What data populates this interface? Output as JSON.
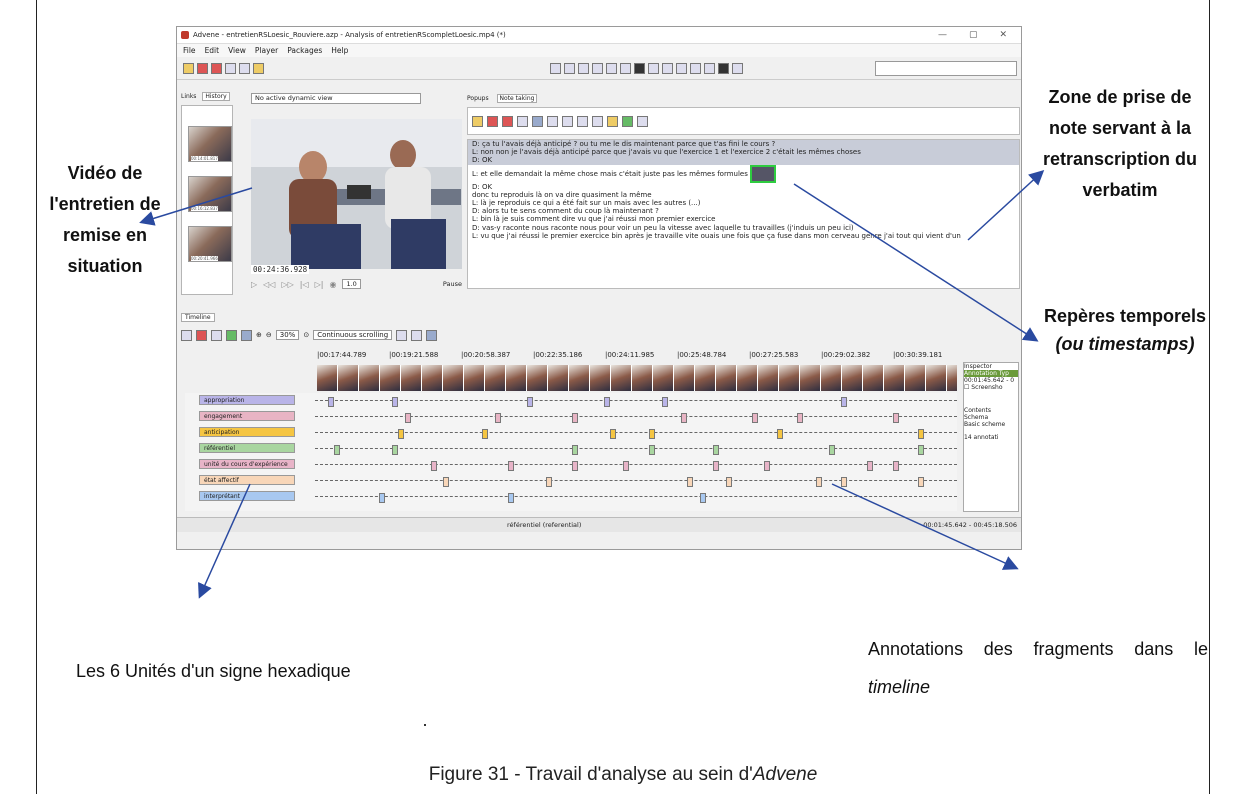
{
  "window": {
    "title": "Advene - entretienRSLoesic_Rouviere.azp - Analysis of entretienRScompletLoesic.mp4 (*)",
    "menu": [
      "File",
      "Edit",
      "View",
      "Player",
      "Packages",
      "Help"
    ],
    "left_tabs": [
      "Links",
      "History"
    ],
    "dynamic_view": "No active dynamic view",
    "video_time": "00:24:36.928",
    "speed": "1.0",
    "pause": "Pause",
    "note_tabs": [
      "Popups",
      "Note taking"
    ],
    "notes": [
      "D: ça tu l'avais déjà anticipé ? ou tu me le dis maintenant parce que t'as fini le cours ?",
      "L: non non je l'avais déjà anticipé parce que j'avais vu que l'exercice 1 et l'exercice 2 c'était les mêmes choses",
      "D: OK",
      "",
      "L: et elle demandait la même chose mais c'était juste pas les mêmes formules",
      "D: OK",
      "donc tu reproduis là on va dire quasiment la même",
      "L: là je reproduis ce qui a été fait sur un mais avec les autres (...)",
      "D: alors tu te sens comment du coup là maintenant ?",
      "L: bin là je suis comment dire vu que j'ai réussi mon premier exercice",
      "D: vas-y raconte nous raconte nous pour voir un peu la vitesse avec laquelle tu travailles (j'induis un peu ici)",
      "L: vu que j'ai réussi le premier exercice bin après je travaille vite ouais une fois que ça fuse dans mon cerveau genre j'ai tout qui vient d'un"
    ],
    "timeline_tab": "Timeline",
    "zoom": "30%",
    "scroll_mode": "Continuous scrolling",
    "ticks": [
      "|00:17:44.789",
      "|00:19:21.588",
      "|00:20:58.387",
      "|00:22:35.186",
      "|00:24:11.985",
      "|00:25:48.784",
      "|00:27:25.583",
      "|00:29:02.382",
      "|00:30:39.181"
    ],
    "rows": [
      {
        "label": "appropriation",
        "color": "#b9b4e8"
      },
      {
        "label": "engagement",
        "color": "#e8b4c4"
      },
      {
        "label": "anticipation",
        "color": "#f5c542"
      },
      {
        "label": "référentiel",
        "color": "#a9d6a0"
      },
      {
        "label": "unité du cours d'expérience",
        "color": "#e8b4c8"
      },
      {
        "label": "état affectif",
        "color": "#f8d6b8"
      },
      {
        "label": "interprétant",
        "color": "#a8c8f0"
      }
    ],
    "status_center": "référentiel (referential)",
    "status_right": "00:01:45.642 - 00:45:18.506",
    "inspector": {
      "title": "Inspector",
      "type": "Annotation Typ",
      "time": "00:01:45.642 - 0",
      "check": "Screensho",
      "contents": "Contents",
      "schema": "Schema",
      "schema_val": "Basic scheme",
      "count": "14 annotati"
    }
  },
  "annotations": {
    "video": "Vidéo de l'entretien de remise en situation",
    "notes": "Zone de prise de note servant à la retranscription du verbatim",
    "timestamps_1": "Repères temporels",
    "timestamps_2": "(ou timestamps)",
    "units": "Les 6 Unités d'un signe hexadique",
    "fragments_1": "Annotations des fragments dans le",
    "fragments_2": "timeline"
  },
  "caption": {
    "prefix": "Figure 31 - Travail d'analyse au sein d'",
    "italic": "Advene"
  }
}
